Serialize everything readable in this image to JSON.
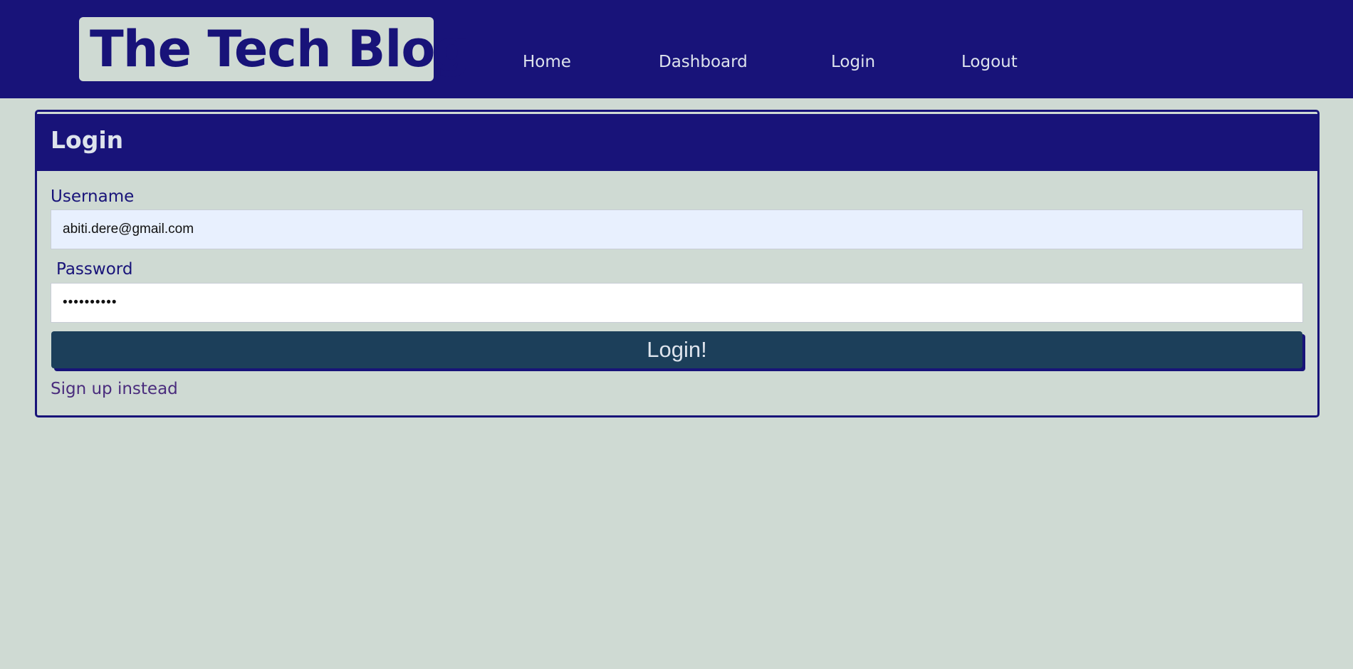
{
  "header": {
    "logo_text": "The Tech Blog",
    "nav": [
      {
        "label": "Home"
      },
      {
        "label": "Dashboard"
      },
      {
        "label": "Login"
      },
      {
        "label": "Logout"
      }
    ]
  },
  "login_card": {
    "title": "Login",
    "username_label": "Username",
    "username_value": "abiti.dere@gmail.com",
    "password_label": "Password",
    "password_value": "••••••••••",
    "submit_label": "Login!",
    "signup_link": "Sign up instead"
  },
  "colors": {
    "primary": "#181379",
    "background": "#cfdad3",
    "button": "#1c3f5a",
    "link": "#4a2c7d"
  }
}
